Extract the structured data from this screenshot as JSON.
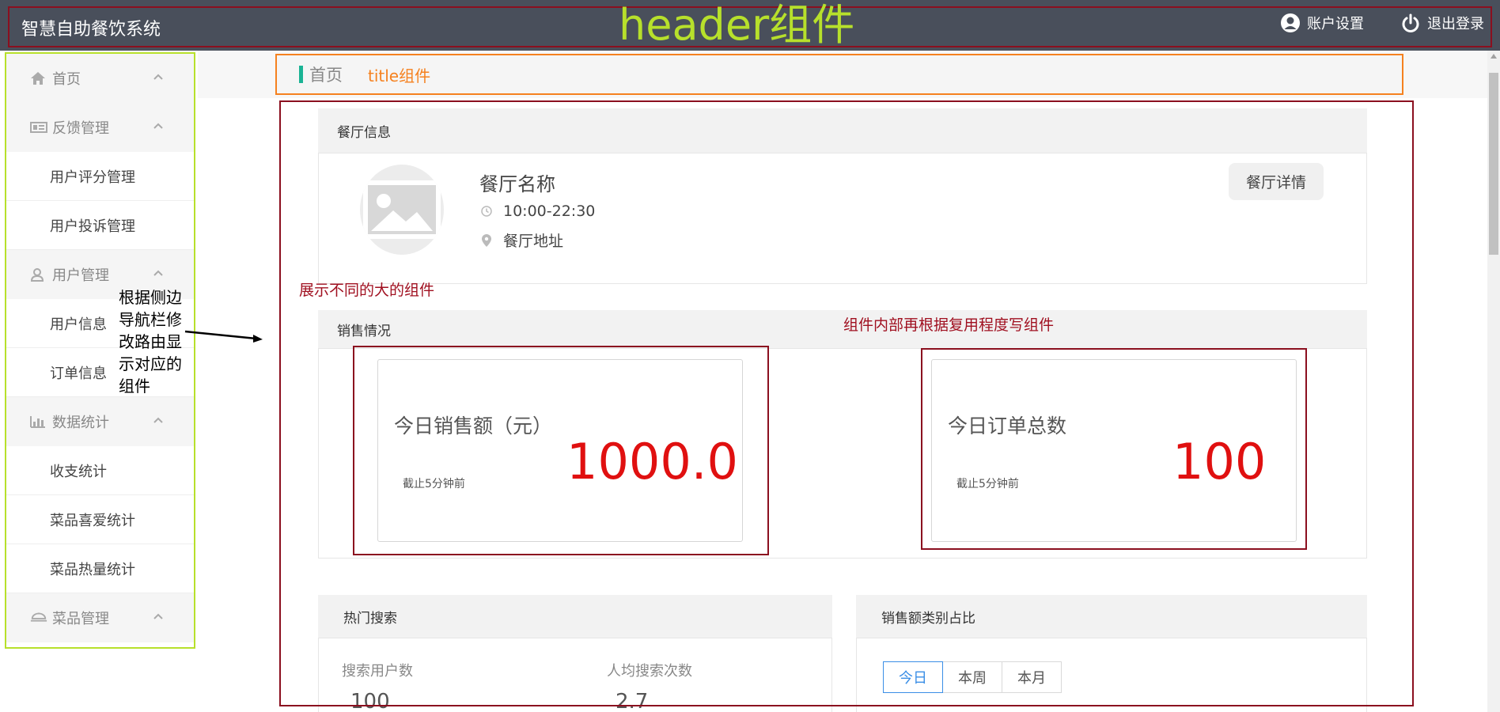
{
  "header": {
    "app_title": "智慧自助餐饮系统",
    "annotation": "header组件",
    "account_settings": "账户设置",
    "logout": "退出登录",
    "account_icon": "user-circle-icon",
    "logout_icon": "power-icon"
  },
  "sidebar": {
    "groups": [
      {
        "label": "首页",
        "icon": "home-icon"
      },
      {
        "label": "反馈管理",
        "icon": "feedback-icon",
        "items": [
          "用户评分管理",
          "用户投诉管理"
        ]
      },
      {
        "label": "用户管理",
        "icon": "user-icon",
        "items": [
          "用户信息",
          "订单信息"
        ]
      },
      {
        "label": "数据统计",
        "icon": "bar-chart-icon",
        "items": [
          "收支统计",
          "菜品喜爱统计",
          "菜品热量统计"
        ]
      },
      {
        "label": "菜品管理",
        "icon": "dish-icon"
      }
    ],
    "annotation": "根据侧边导航栏修改路由显示对应的组件"
  },
  "title_bar": {
    "breadcrumb": "首页",
    "annotation": "title组件"
  },
  "restaurant": {
    "section_title": "餐厅信息",
    "name": "餐厅名称",
    "hours": "10:00-22:30",
    "address": "餐厅地址",
    "detail_button": "餐厅详情"
  },
  "annotations": {
    "big_components": "展示不同的大的组件",
    "sub_components": "组件内部再根据复用程度写组件"
  },
  "sales": {
    "section_title": "销售情况",
    "cards": [
      {
        "label": "今日销售额（元）",
        "value": "1000.0",
        "note": "截止5分钟前"
      },
      {
        "label": "今日订单总数",
        "value": "100",
        "note": "截止5分钟前"
      }
    ]
  },
  "hot_search": {
    "section_title": "热门搜索",
    "search_users_label": "搜索用户数",
    "search_users_value": "100",
    "avg_search_label": "人均搜索次数",
    "avg_search_value": "2.7"
  },
  "category_share": {
    "section_title": "销售额类别占比",
    "tabs": [
      "今日",
      "本周",
      "本月"
    ],
    "active_tab": "今日"
  },
  "colors": {
    "header_bg": "#494f5b",
    "accent_green": "#1ab394",
    "annotation_lime": "#b7e02b",
    "annotation_orange": "#f5811f",
    "annotation_red": "#8b0f1f",
    "value_red": "#e01010",
    "tab_blue": "#3a8ee6"
  }
}
